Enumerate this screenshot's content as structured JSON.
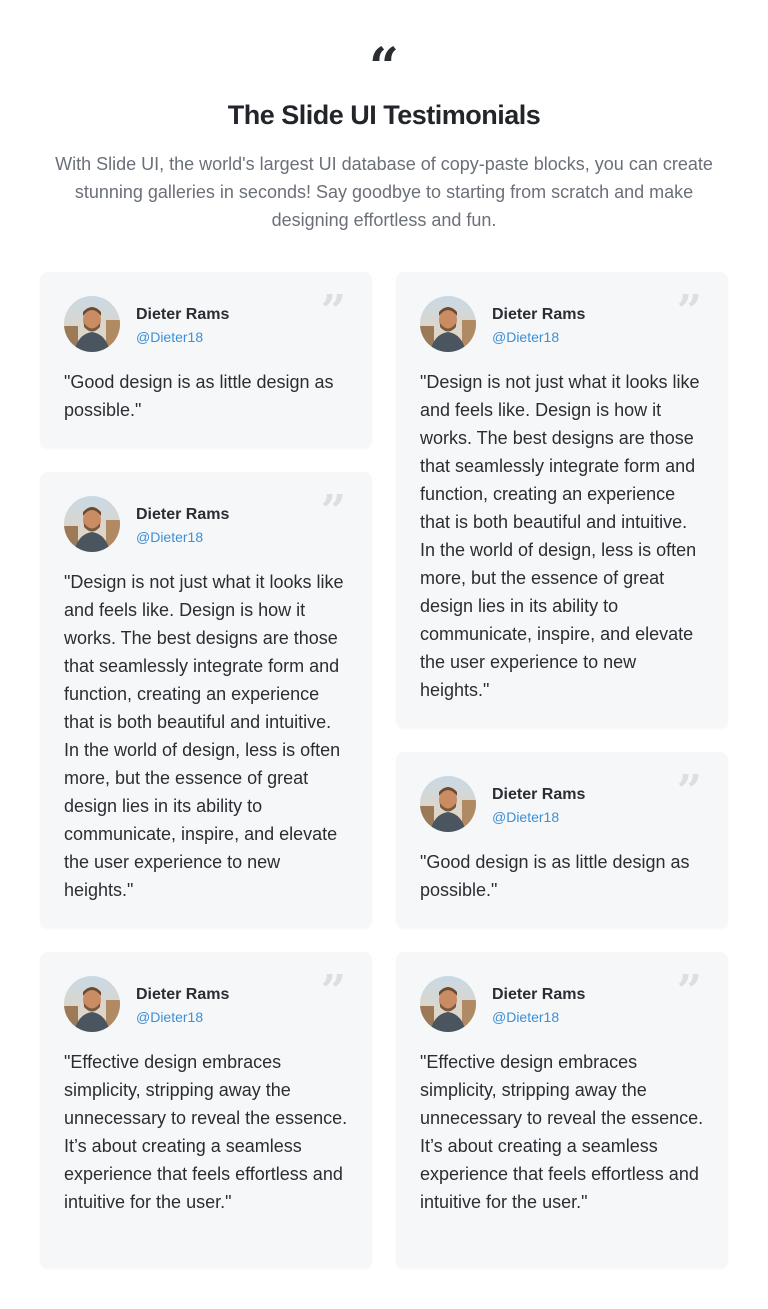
{
  "header": {
    "quote_glyph": "“",
    "title": "The Slide UI Testimonials",
    "subtitle": "With Slide UI, the world's largest UI database of copy-paste blocks, you can create stunning galleries in seconds! Say goodbye to starting from scratch and make designing effortless and fun."
  },
  "card_quote_glyph": "”",
  "testimonials": [
    {
      "name": "Dieter Rams",
      "handle": "@Dieter18",
      "text": "\"Good design is as little design as possible.\""
    },
    {
      "name": "Dieter Rams",
      "handle": "@Dieter18",
      "text": "\"Design is not just what it looks like and feels like. Design is how it works. The best designs are those that seamlessly integrate form and function, creating an experience that is both beautiful and intuitive. In the world of design, less is often more, but the essence of great design lies in its ability to communicate, inspire, and elevate the user experience to new heights.\""
    },
    {
      "name": "Dieter Rams",
      "handle": "@Dieter18",
      "text": "\"Design is not just what it looks like and feels like. Design is how it works. The best designs are those that seamlessly integrate form and function, creating an experience that is both beautiful and intuitive. In the world of design, less is often more, but the essence of great design lies in its ability to communicate, inspire, and elevate the user experience to new heights.\""
    },
    {
      "name": "Dieter Rams",
      "handle": "@Dieter18",
      "text": "\"Good design is as little design as possible.\""
    },
    {
      "name": "Dieter Rams",
      "handle": "@Dieter18",
      "text": "\"Effective design embraces simplicity, stripping away the unnecessary to reveal the essence. It’s about creating a seamless experience that feels effortless and intuitive for the user.\""
    },
    {
      "name": "Dieter Rams",
      "handle": "@Dieter18",
      "text": "\"Effective design embraces simplicity, stripping away the unnecessary to reveal the essence. It’s about creating a seamless experience that feels effortless and intuitive for the user.\""
    }
  ],
  "colors": {
    "card_background": "#f6f7f9",
    "handle": "#3b8fd6",
    "quote_icon": "#dcdee2"
  }
}
